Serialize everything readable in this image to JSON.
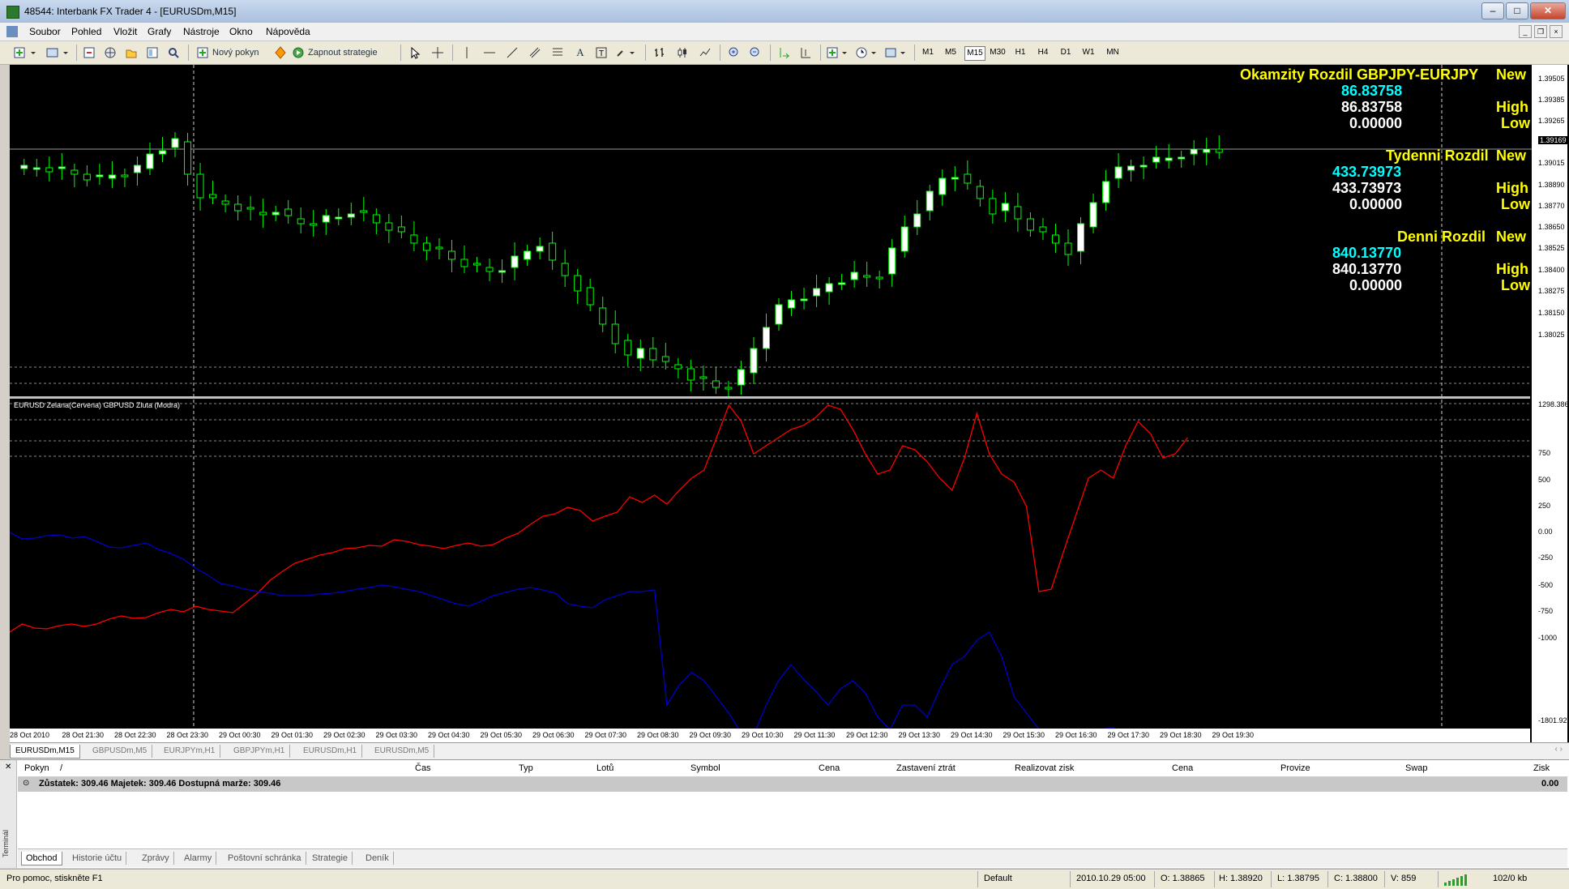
{
  "window": {
    "title": "48544: Interbank FX Trader 4 - [EURUSDm,M15]"
  },
  "menu": {
    "items": [
      "Soubor",
      "Pohled",
      "Vložit",
      "Grafy",
      "Nástroje",
      "Okno",
      "Nápověda"
    ]
  },
  "toolbar": {
    "new_order_label": "Nový pokyn",
    "strategies_label": "Zapnout strategie",
    "timeframes": [
      "M1",
      "M5",
      "M15",
      "M30",
      "H1",
      "H4",
      "D1",
      "W1",
      "MN"
    ],
    "active_timeframe": "M15"
  },
  "chart": {
    "price_axis": [
      "1.39505",
      "1.39385",
      "1.39265",
      "1.39169",
      "1.39015",
      "1.38890",
      "1.38770",
      "1.38650",
      "1.38525",
      "1.38400",
      "1.38275",
      "1.38150",
      "1.38025"
    ],
    "current_price": "1.39169",
    "indicator_axis": [
      "1298.386",
      "750",
      "500",
      "250",
      "0.00",
      "-250",
      "-500",
      "-750",
      "-1000",
      "-1801.92"
    ],
    "time_axis": [
      "28 Oct 2010",
      "28 Oct 21:30",
      "28 Oct 22:30",
      "28 Oct 23:30",
      "29 Oct 00:30",
      "29 Oct 01:30",
      "29 Oct 02:30",
      "29 Oct 03:30",
      "29 Oct 04:30",
      "29 Oct 05:30",
      "29 Oct 06:30",
      "29 Oct 07:30",
      "29 Oct 08:30",
      "29 Oct 09:30",
      "29 Oct 10:30",
      "29 Oct 11:30",
      "29 Oct 12:30",
      "29 Oct 13:30",
      "29 Oct 14:30",
      "29 Oct 15:30",
      "29 Oct 16:30",
      "29 Oct 17:30",
      "29 Oct 18:30",
      "29 Oct 19:30"
    ],
    "indicator_title": "EURUSD Zelana(Cervena) GBPUSD Zluta (Modra)",
    "overlay": {
      "okamzity_title": "Okamzity Rozdil GBPJPY-EURJPY",
      "okamzity_value": "86.83758",
      "okamzity_high": "86.83758",
      "okamzity_low": "0.00000",
      "tydenni_title": "Tydenni Rozdil",
      "tydenni_value": "433.73973",
      "tydenni_high": "433.73973",
      "tydenni_low": "0.00000",
      "denni_title": "Denni Rozdil",
      "denni_value": "840.13770",
      "denni_high": "840.13770",
      "denni_low": "0.00000",
      "new_label": "New",
      "high_label": "High",
      "low_label": "Low"
    },
    "colors": {
      "bull": "#ffffff",
      "bear": "#000000",
      "wick": "#00ff00",
      "red_line": "#ff0000",
      "blue_line": "#0000c8",
      "overlay_yellow": "#ffff00",
      "overlay_cyan": "#00ffff"
    }
  },
  "chart_tabs": [
    "EURUSDm,M15",
    "GBPUSDm,M5",
    "EURJPYm,H1",
    "GBPJPYm,H1",
    "EURUSDm,H1",
    "EURUSDm,M5"
  ],
  "terminal": {
    "side_label": "Terminál",
    "columns": [
      "Pokyn",
      "/",
      "Čas",
      "Typ",
      "Lotů",
      "Symbol",
      "Cena",
      "Zastavení ztrát",
      "Realizovat zisk",
      "Cena",
      "Provize",
      "Swap",
      "Zisk"
    ],
    "balance_row": "Zůstatek: 309.46  Majetek: 309.46  Dostupná marže: 309.46",
    "balance_profit": "0.00",
    "tabs": [
      "Obchod",
      "Historie účtu",
      "Zprávy",
      "Alarmy",
      "Poštovní schránka",
      "Strategie",
      "Deník"
    ]
  },
  "status": {
    "help": "Pro pomoc, stiskněte F1",
    "profile": "Default",
    "datetime": "2010.10.29 05:00",
    "open": "O: 1.38865",
    "high": "H: 1.38920",
    "low": "L: 1.38795",
    "close": "C: 1.38800",
    "volume": "V: 859",
    "traffic": "102/0 kb"
  }
}
